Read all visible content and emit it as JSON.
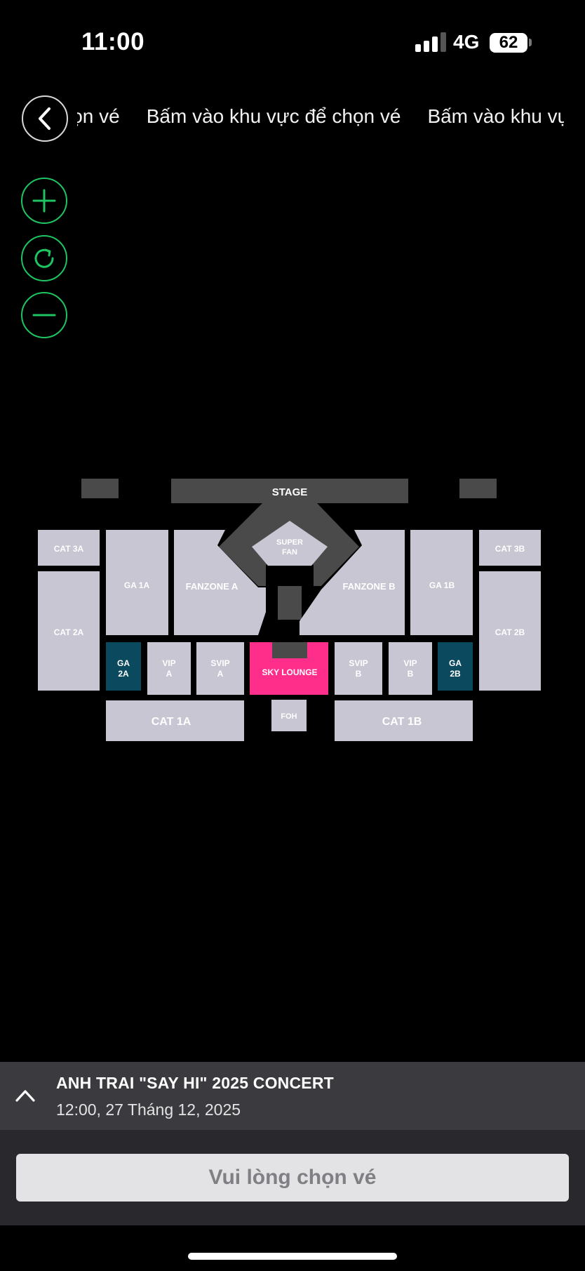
{
  "status_bar": {
    "time": "11:00",
    "network": "4G",
    "battery": "62"
  },
  "header": {
    "back_icon": "chevron-left-icon",
    "marquee_partial_start": "vé",
    "marquee_text": "Bấm vào khu vực để chọn vé",
    "marquee_partial_end": "Bấm vào khu vự"
  },
  "zoom_controls": {
    "icons": [
      "plus-icon",
      "refresh-icon",
      "minus-icon"
    ],
    "accent": "#1ec461"
  },
  "seat_map": {
    "colors": {
      "available": "#c7c6d2",
      "stage": "#4a4a4a",
      "selected": "#ff2e8a",
      "ga": "#0b4a5e"
    },
    "stage": "STAGE",
    "super_fan": [
      "SUPER",
      "FAN"
    ],
    "cat_3a": "CAT 3A",
    "cat_3b": "CAT 3B",
    "cat_2a": "CAT 2A",
    "cat_2b": "CAT 2B",
    "ga_1a": "GA 1A",
    "ga_1b": "GA 1B",
    "fanzone_a": "FANZONE A",
    "fanzone_b": "FANZONE B",
    "ga_2a": [
      "GA",
      "2A"
    ],
    "ga_2b": [
      "GA",
      "2B"
    ],
    "vip_a": [
      "VIP",
      "A"
    ],
    "vip_b": [
      "VIP",
      "B"
    ],
    "svip_a": [
      "SVIP",
      "A"
    ],
    "svip_b": [
      "SVIP",
      "B"
    ],
    "sky_lounge": "SKY LOUNGE",
    "foh": "FOH",
    "cat_1a": "CAT 1A",
    "cat_1b": "CAT 1B"
  },
  "event": {
    "title": "ANH TRAI \"SAY HI\" 2025 CONCERT",
    "datetime": "12:00, 27  Tháng  12, 2025",
    "toggle_icon": "chevron-up-icon"
  },
  "action": {
    "button_label": "Vui lòng chọn vé"
  }
}
